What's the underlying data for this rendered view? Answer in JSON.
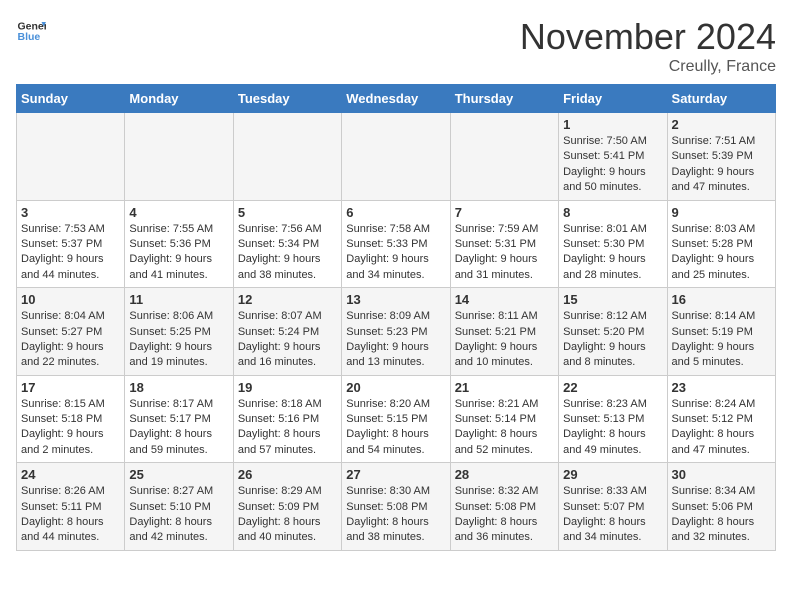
{
  "header": {
    "logo_general": "General",
    "logo_blue": "Blue",
    "month_title": "November 2024",
    "location": "Creully, France"
  },
  "weekdays": [
    "Sunday",
    "Monday",
    "Tuesday",
    "Wednesday",
    "Thursday",
    "Friday",
    "Saturday"
  ],
  "weeks": [
    [
      {
        "day": "",
        "info": ""
      },
      {
        "day": "",
        "info": ""
      },
      {
        "day": "",
        "info": ""
      },
      {
        "day": "",
        "info": ""
      },
      {
        "day": "",
        "info": ""
      },
      {
        "day": "1",
        "info": "Sunrise: 7:50 AM\nSunset: 5:41 PM\nDaylight: 9 hours and 50 minutes."
      },
      {
        "day": "2",
        "info": "Sunrise: 7:51 AM\nSunset: 5:39 PM\nDaylight: 9 hours and 47 minutes."
      }
    ],
    [
      {
        "day": "3",
        "info": "Sunrise: 7:53 AM\nSunset: 5:37 PM\nDaylight: 9 hours and 44 minutes."
      },
      {
        "day": "4",
        "info": "Sunrise: 7:55 AM\nSunset: 5:36 PM\nDaylight: 9 hours and 41 minutes."
      },
      {
        "day": "5",
        "info": "Sunrise: 7:56 AM\nSunset: 5:34 PM\nDaylight: 9 hours and 38 minutes."
      },
      {
        "day": "6",
        "info": "Sunrise: 7:58 AM\nSunset: 5:33 PM\nDaylight: 9 hours and 34 minutes."
      },
      {
        "day": "7",
        "info": "Sunrise: 7:59 AM\nSunset: 5:31 PM\nDaylight: 9 hours and 31 minutes."
      },
      {
        "day": "8",
        "info": "Sunrise: 8:01 AM\nSunset: 5:30 PM\nDaylight: 9 hours and 28 minutes."
      },
      {
        "day": "9",
        "info": "Sunrise: 8:03 AM\nSunset: 5:28 PM\nDaylight: 9 hours and 25 minutes."
      }
    ],
    [
      {
        "day": "10",
        "info": "Sunrise: 8:04 AM\nSunset: 5:27 PM\nDaylight: 9 hours and 22 minutes."
      },
      {
        "day": "11",
        "info": "Sunrise: 8:06 AM\nSunset: 5:25 PM\nDaylight: 9 hours and 19 minutes."
      },
      {
        "day": "12",
        "info": "Sunrise: 8:07 AM\nSunset: 5:24 PM\nDaylight: 9 hours and 16 minutes."
      },
      {
        "day": "13",
        "info": "Sunrise: 8:09 AM\nSunset: 5:23 PM\nDaylight: 9 hours and 13 minutes."
      },
      {
        "day": "14",
        "info": "Sunrise: 8:11 AM\nSunset: 5:21 PM\nDaylight: 9 hours and 10 minutes."
      },
      {
        "day": "15",
        "info": "Sunrise: 8:12 AM\nSunset: 5:20 PM\nDaylight: 9 hours and 8 minutes."
      },
      {
        "day": "16",
        "info": "Sunrise: 8:14 AM\nSunset: 5:19 PM\nDaylight: 9 hours and 5 minutes."
      }
    ],
    [
      {
        "day": "17",
        "info": "Sunrise: 8:15 AM\nSunset: 5:18 PM\nDaylight: 9 hours and 2 minutes."
      },
      {
        "day": "18",
        "info": "Sunrise: 8:17 AM\nSunset: 5:17 PM\nDaylight: 8 hours and 59 minutes."
      },
      {
        "day": "19",
        "info": "Sunrise: 8:18 AM\nSunset: 5:16 PM\nDaylight: 8 hours and 57 minutes."
      },
      {
        "day": "20",
        "info": "Sunrise: 8:20 AM\nSunset: 5:15 PM\nDaylight: 8 hours and 54 minutes."
      },
      {
        "day": "21",
        "info": "Sunrise: 8:21 AM\nSunset: 5:14 PM\nDaylight: 8 hours and 52 minutes."
      },
      {
        "day": "22",
        "info": "Sunrise: 8:23 AM\nSunset: 5:13 PM\nDaylight: 8 hours and 49 minutes."
      },
      {
        "day": "23",
        "info": "Sunrise: 8:24 AM\nSunset: 5:12 PM\nDaylight: 8 hours and 47 minutes."
      }
    ],
    [
      {
        "day": "24",
        "info": "Sunrise: 8:26 AM\nSunset: 5:11 PM\nDaylight: 8 hours and 44 minutes."
      },
      {
        "day": "25",
        "info": "Sunrise: 8:27 AM\nSunset: 5:10 PM\nDaylight: 8 hours and 42 minutes."
      },
      {
        "day": "26",
        "info": "Sunrise: 8:29 AM\nSunset: 5:09 PM\nDaylight: 8 hours and 40 minutes."
      },
      {
        "day": "27",
        "info": "Sunrise: 8:30 AM\nSunset: 5:08 PM\nDaylight: 8 hours and 38 minutes."
      },
      {
        "day": "28",
        "info": "Sunrise: 8:32 AM\nSunset: 5:08 PM\nDaylight: 8 hours and 36 minutes."
      },
      {
        "day": "29",
        "info": "Sunrise: 8:33 AM\nSunset: 5:07 PM\nDaylight: 8 hours and 34 minutes."
      },
      {
        "day": "30",
        "info": "Sunrise: 8:34 AM\nSunset: 5:06 PM\nDaylight: 8 hours and 32 minutes."
      }
    ]
  ]
}
